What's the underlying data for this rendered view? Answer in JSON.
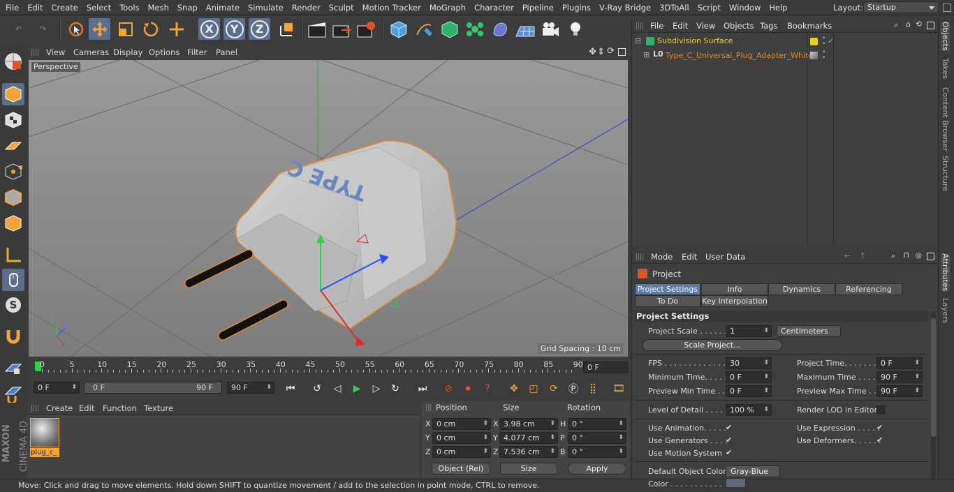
{
  "menubar": {
    "items": [
      "File",
      "Edit",
      "Create",
      "Select",
      "Tools",
      "Mesh",
      "Snap",
      "Animate",
      "Simulate",
      "Render",
      "Sculpt",
      "Motion Tracker",
      "MoGraph",
      "Character",
      "Pipeline",
      "Plugins",
      "V-Ray Bridge",
      "3DToAll",
      "Script",
      "Window",
      "Help"
    ],
    "layout_label": "Layout:",
    "layout_value": "Startup"
  },
  "toolbar": {
    "axis_x": "X",
    "axis_y": "Y",
    "axis_z": "Z"
  },
  "viewport": {
    "menu": [
      "View",
      "Cameras",
      "Display",
      "Options",
      "Filter",
      "Panel"
    ],
    "camera_label": "Perspective",
    "grid_spacing": "Grid Spacing : 10 cm",
    "model_text": "TYPE C"
  },
  "timeline": {
    "ticks": [
      "0",
      "5",
      "10",
      "15",
      "20",
      "25",
      "30",
      "35",
      "40",
      "45",
      "50",
      "55",
      "60",
      "65",
      "70",
      "75",
      "80",
      "85",
      "90"
    ],
    "current_frame": "0 F",
    "start_frame": "0 F",
    "range_start": "0 F",
    "range_end": "90 F",
    "end_frame": "90 F"
  },
  "materials": {
    "menu": [
      "Create",
      "Edit",
      "Function",
      "Texture"
    ],
    "item_label": "plug_c_"
  },
  "coords": {
    "headers": {
      "position": "Position",
      "size": "Size",
      "rotation": "Rotation"
    },
    "rows": [
      {
        "axis": "X",
        "pos": "0 cm",
        "size_axis": "X",
        "size": "3.98 cm",
        "rot_axis": "H",
        "rot": "0 °"
      },
      {
        "axis": "Y",
        "pos": "0 cm",
        "size_axis": "Y",
        "size": "4.077 cm",
        "rot_axis": "P",
        "rot": "0 °"
      },
      {
        "axis": "Z",
        "pos": "0 cm",
        "size_axis": "Z",
        "size": "7.536 cm",
        "rot_axis": "B",
        "rot": "0 °"
      }
    ],
    "mode": "Object (Rel)",
    "size_mode": "Size",
    "apply": "Apply"
  },
  "status": "Move: Click and drag to move elements. Hold down SHIFT to quantize movement / add to the selection in point mode, CTRL to remove.",
  "brand": {
    "line1": "MAXON",
    "line2": "CINEMA 4D"
  },
  "objects": {
    "menu": [
      "File",
      "Edit",
      "View",
      "Objects",
      "Tags",
      "Bookmarks"
    ],
    "items": [
      {
        "name": "Subdivision Surface"
      },
      {
        "name": "Type_C_Universal_Plug_Adapter_White"
      }
    ]
  },
  "attributes": {
    "menu": [
      "Mode",
      "Edit",
      "User Data"
    ],
    "title": "Project",
    "tabs_row1": [
      "Project Settings",
      "Info",
      "Dynamics",
      "Referencing"
    ],
    "tabs_row2": [
      "To Do",
      "Key Interpolation"
    ],
    "section": "Project Settings",
    "project_scale_label": "Project Scale . . . . . .",
    "project_scale_value": "1",
    "project_scale_unit": "Centimeters",
    "scale_project_btn": "Scale Project...",
    "fps_label": "FPS . . . . . . . . . . . . . .",
    "fps_value": "30",
    "project_time_label": "Project Time. . . . . . . .",
    "project_time_value": "0 F",
    "min_time_label": "Minimum Time. . . . . .",
    "min_time_value": "0 F",
    "max_time_label": "Maximum Time . . . . . .",
    "max_time_value": "90 F",
    "prev_min_label": "Preview Min Time . . .",
    "prev_min_value": "0 F",
    "prev_max_label": "Preview Max Time . . .",
    "prev_max_value": "90 F",
    "lod_label": "Level of Detail . . . . .",
    "lod_value": "100 %",
    "render_lod_label": "Render LOD in Editor",
    "use_animation": "Use Animation. . . . .",
    "use_expression": "Use Expression . . . . .",
    "use_generators": "Use Generators . . . .",
    "use_deformers": "Use Deformers. . . . . .",
    "use_motion": "Use Motion System",
    "default_color_label": "Default Object Color",
    "default_color_value": "Gray-Blue",
    "color_label": "Color . . . . . . . . . . ."
  },
  "side_tabs": [
    "Objects",
    "Takes",
    "Content Browser",
    "Structure",
    "Attributes",
    "Layers"
  ]
}
